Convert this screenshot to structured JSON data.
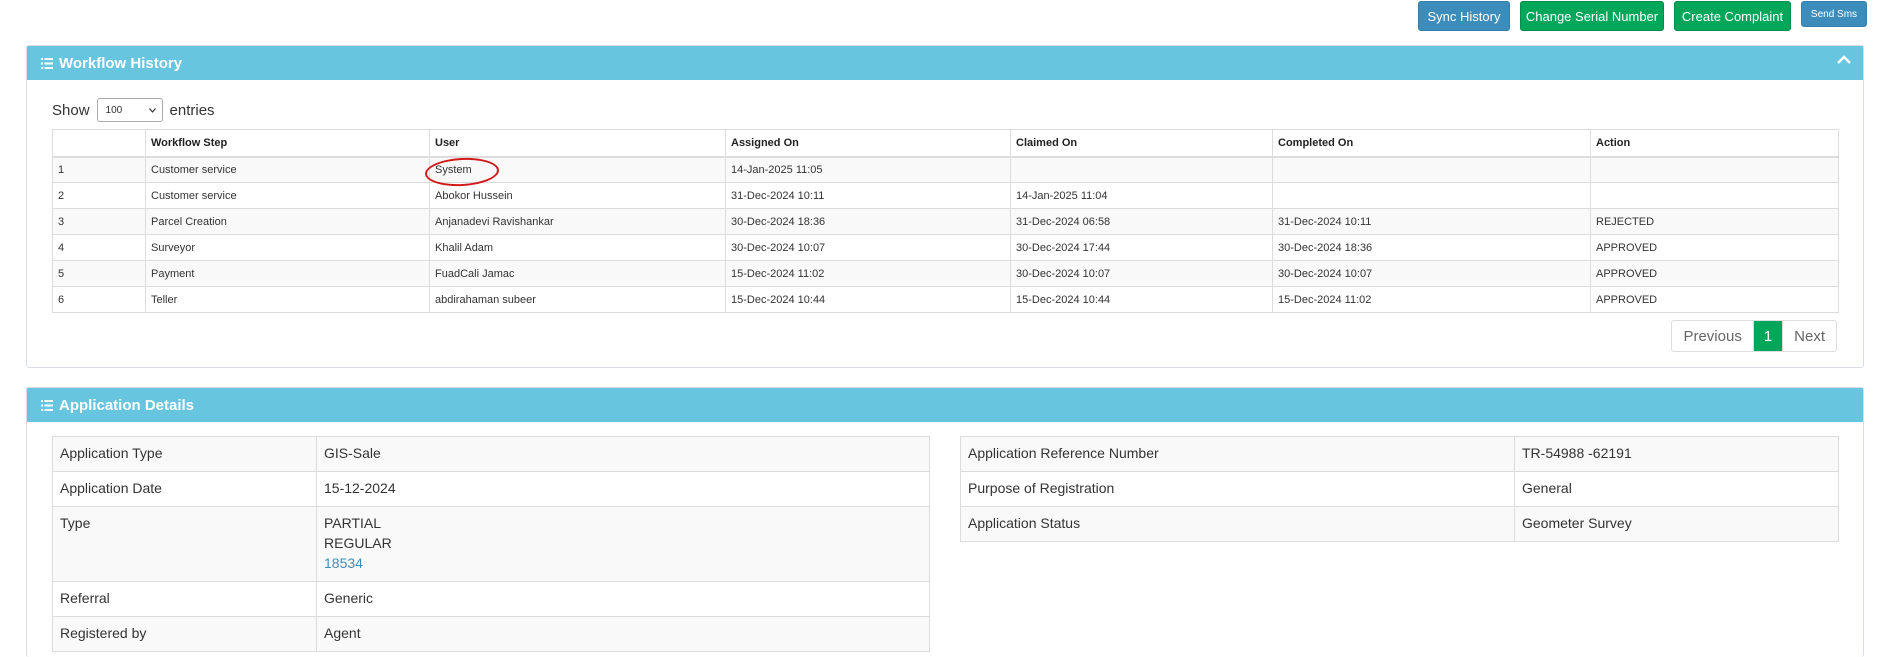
{
  "toolbar": {
    "sync_history": "Sync History",
    "change_serial": "Change Serial Number",
    "create_complaint": "Create Complaint",
    "send_sms": "Send Sms"
  },
  "workflow": {
    "title": "Workflow History",
    "show_label": "Show",
    "entries_label": "entries",
    "page_size": "100",
    "columns": [
      "",
      "Workflow Step",
      "User",
      "Assigned On",
      "Claimed On",
      "Completed On",
      "Action"
    ],
    "rows": [
      {
        "n": "1",
        "step": "Customer service",
        "user": "System",
        "assigned": "14-Jan-2025 11:05",
        "claimed": "",
        "completed": "",
        "action": ""
      },
      {
        "n": "2",
        "step": "Customer service",
        "user": "Abokor Hussein",
        "assigned": "31-Dec-2024 10:11",
        "claimed": "14-Jan-2025 11:04",
        "completed": "",
        "action": ""
      },
      {
        "n": "3",
        "step": "Parcel Creation",
        "user": "Anjanadevi Ravishankar",
        "assigned": "30-Dec-2024 18:36",
        "claimed": "31-Dec-2024 06:58",
        "completed": "31-Dec-2024 10:11",
        "action": "REJECTED"
      },
      {
        "n": "4",
        "step": "Surveyor",
        "user": "Khalil Adam",
        "assigned": "30-Dec-2024 10:07",
        "claimed": "30-Dec-2024 17:44",
        "completed": "30-Dec-2024 18:36",
        "action": "APPROVED"
      },
      {
        "n": "5",
        "step": "Payment",
        "user": "FuadCali Jamac",
        "assigned": "15-Dec-2024 11:02",
        "claimed": "30-Dec-2024 10:07",
        "completed": "30-Dec-2024 10:07",
        "action": "APPROVED"
      },
      {
        "n": "6",
        "step": "Teller",
        "user": "abdirahaman subeer",
        "assigned": "15-Dec-2024 10:44",
        "claimed": "15-Dec-2024 10:44",
        "completed": "15-Dec-2024 11:02",
        "action": "APPROVED"
      }
    ],
    "pagination": {
      "previous": "Previous",
      "current": "1",
      "next": "Next"
    }
  },
  "details": {
    "title": "Application Details",
    "left": {
      "application_type_label": "Application Type",
      "application_type": "GIS-Sale",
      "application_date_label": "Application Date",
      "application_date": "15-12-2024",
      "type_label": "Type",
      "type_line1": "PARTIAL",
      "type_line2": "REGULAR",
      "type_link": "18534",
      "referral_label": "Referral",
      "referral": "Generic",
      "registered_by_label": "Registered by",
      "registered_by": "Agent"
    },
    "right": {
      "ref_label": "Application Reference Number",
      "ref": "TR-54988 -62191",
      "purpose_label": "Purpose of Registration",
      "purpose": "General",
      "status_label": "Application Status",
      "status": "Geometer Survey"
    }
  },
  "colors": {
    "panel_header": "#67c5e0",
    "btn_blue": "#3c8dbc",
    "btn_green": "#00a65a",
    "rejected": "#dd4b39",
    "approved": "#00a65a",
    "annotation": "#d01a1a"
  },
  "icons": {
    "panel": "list-icon",
    "collapse": "chevron-up-icon"
  }
}
